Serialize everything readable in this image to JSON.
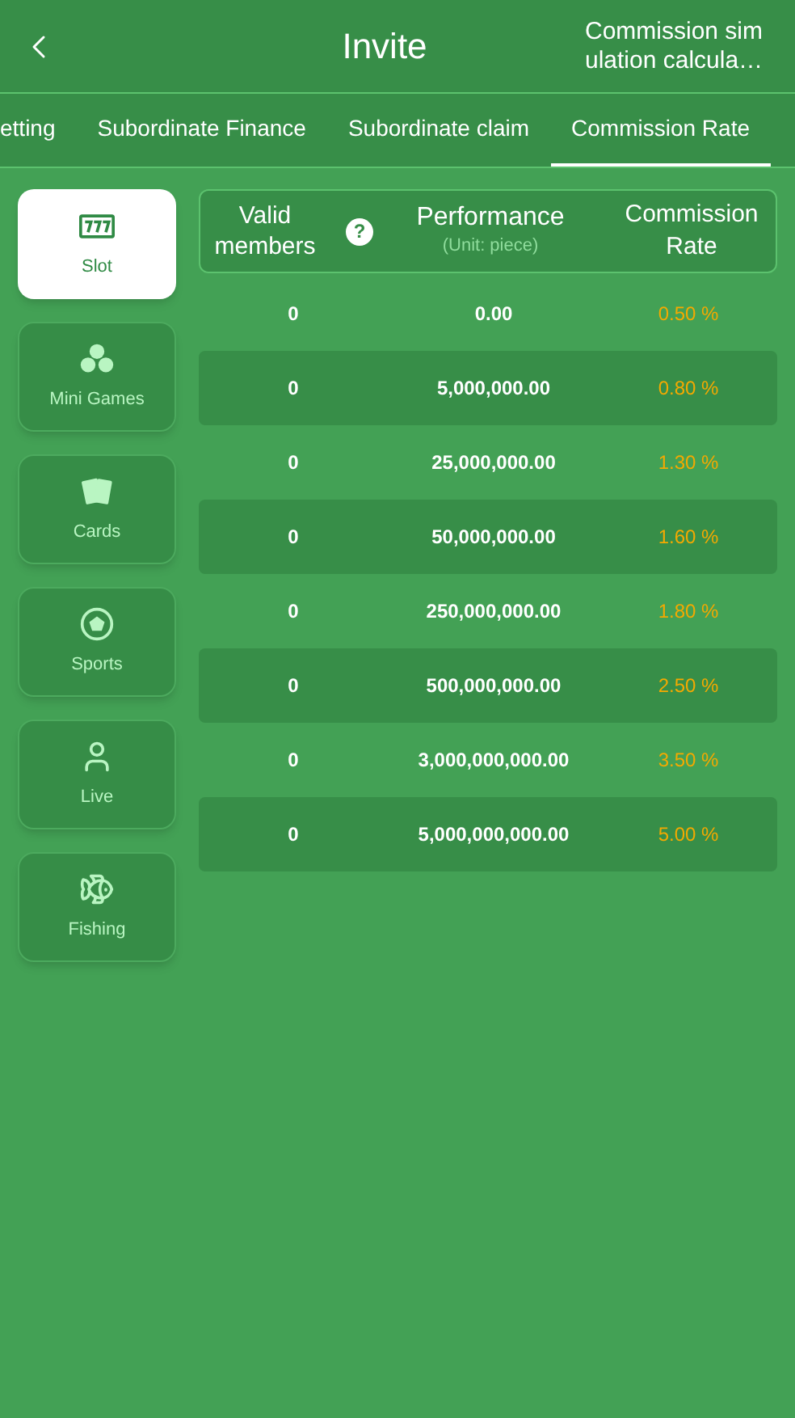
{
  "header": {
    "title": "Invite",
    "action": "Commission sim ulation calcula…"
  },
  "tabs": [
    {
      "label": "etting",
      "selected": false
    },
    {
      "label": "Subordinate Finance",
      "selected": false
    },
    {
      "label": "Subordinate claim",
      "selected": false
    },
    {
      "label": "Commission Rate",
      "selected": true
    }
  ],
  "categories": [
    {
      "kind": "slot",
      "label": "Slot",
      "selected": true
    },
    {
      "kind": "mini",
      "label": "Mini Games",
      "selected": false
    },
    {
      "kind": "cards",
      "label": "Cards",
      "selected": false
    },
    {
      "kind": "sports",
      "label": "Sports",
      "selected": false
    },
    {
      "kind": "live",
      "label": "Live",
      "selected": false
    },
    {
      "kind": "fishing",
      "label": "Fishing",
      "selected": false
    }
  ],
  "table": {
    "columns": [
      {
        "label": "Valid members",
        "help": "?"
      },
      {
        "label": "Performance",
        "unit": "(Unit: piece)"
      },
      {
        "label": "Commission Rate"
      }
    ],
    "rows": [
      [
        "0",
        "0.00",
        "0.50 %"
      ],
      [
        "0",
        "5,000,000.00",
        "0.80 %"
      ],
      [
        "0",
        "25,000,000.00",
        "1.30 %"
      ],
      [
        "0",
        "50,000,000.00",
        "1.60 %"
      ],
      [
        "0",
        "250,000,000.00",
        "1.80 %"
      ],
      [
        "0",
        "500,000,000.00",
        "2.50 %"
      ],
      [
        "0",
        "3,000,000,000.00",
        "3.50 %"
      ],
      [
        "0",
        "5,000,000,000.00",
        "5.00 %"
      ]
    ]
  }
}
